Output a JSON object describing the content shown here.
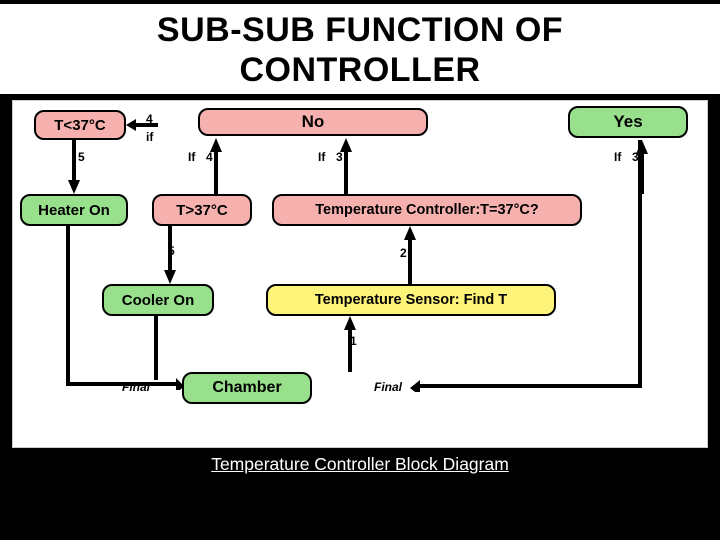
{
  "slide": {
    "title_line1": "SUB-SUB FUNCTION OF",
    "title_line2": "CONTROLLER",
    "caption": "Temperature Controller Block Diagram"
  },
  "boxes": {
    "t_low": "T<37°C",
    "t_high": "T>37°C",
    "no": "No",
    "yes": "Yes",
    "heater": "Heater On",
    "cooler": "Cooler On",
    "tc": "Temperature Controller:T=37°C?",
    "sensor": "Temperature Sensor: Find T",
    "chamber": "Chamber"
  },
  "labels": {
    "four_a": "4",
    "if_a": "if",
    "five_a": "5",
    "if_b": "If",
    "four_b": "4",
    "if_c": "If",
    "three_a": "3",
    "if_d": "If",
    "three_b": "3",
    "five_b": "5",
    "two": "2",
    "one": "1",
    "final_a": "Final",
    "final_b": "Final"
  },
  "colors": {
    "pink": "#f6b1ae",
    "green": "#99e08d",
    "yellow": "#fff47a"
  }
}
